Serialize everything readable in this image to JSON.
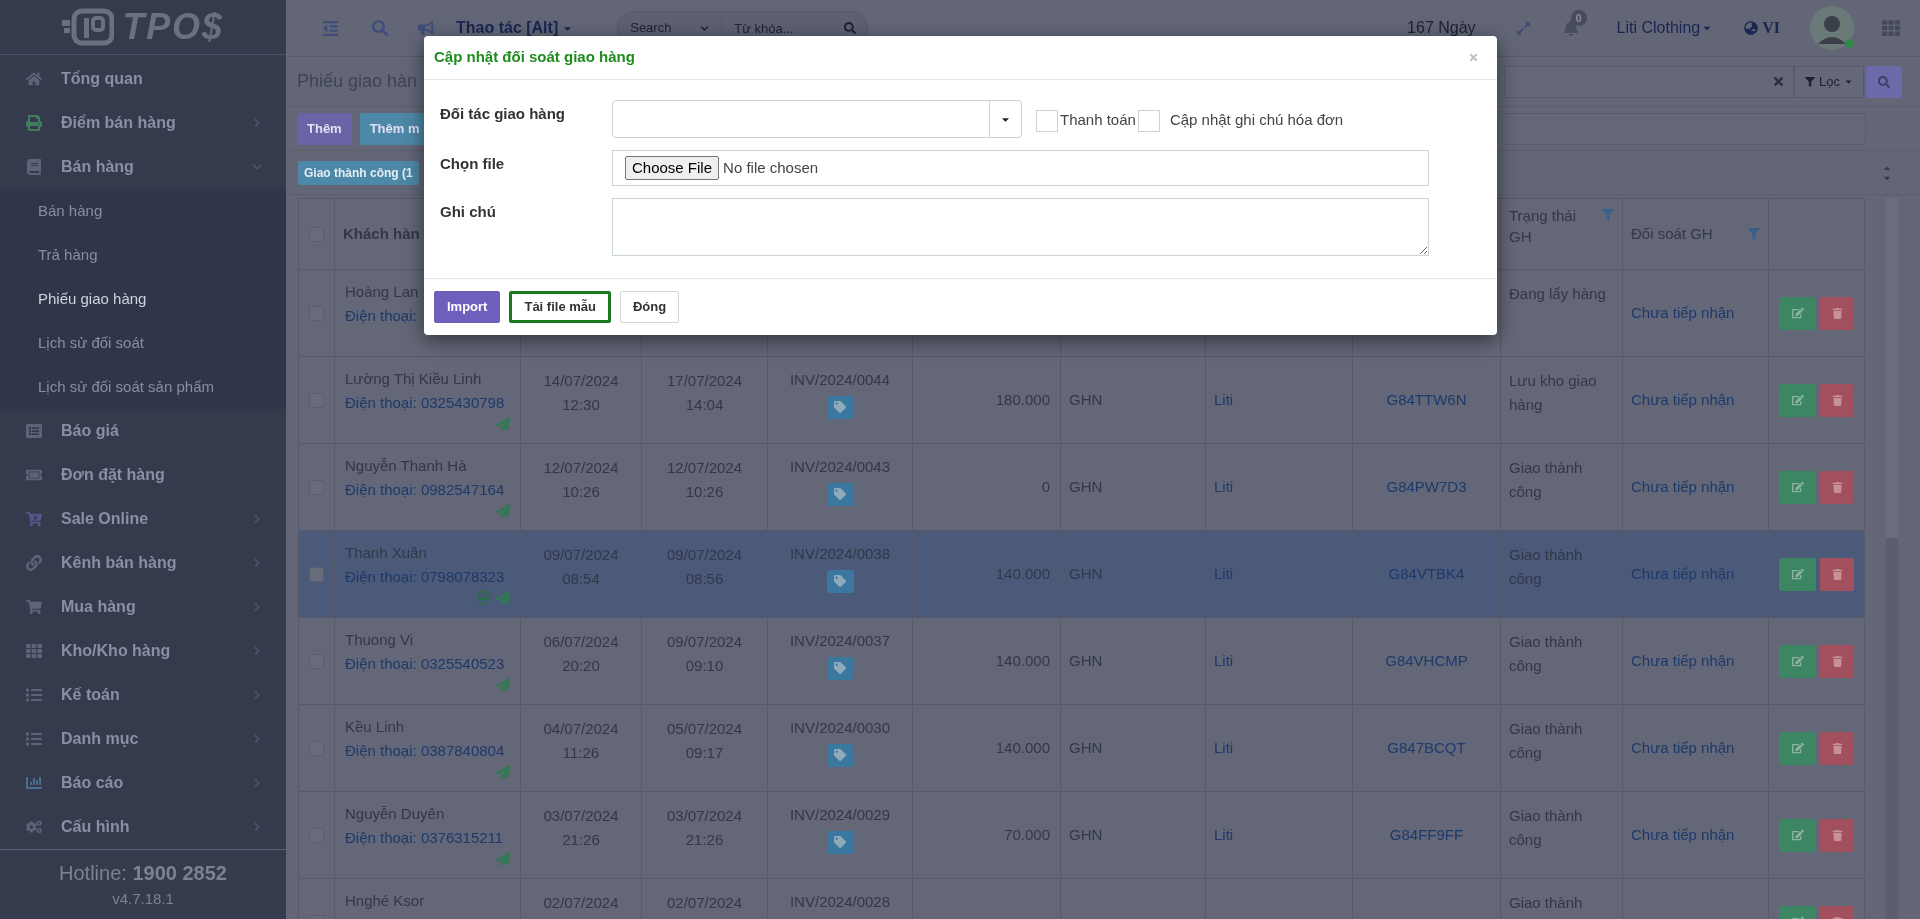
{
  "topbar": {
    "actions_menu": "Thao tác [Alt]",
    "search_scope": "Search",
    "search_placeholder": "Từ khóa...",
    "days_left": "167 Ngày",
    "notifications": "0",
    "company": "Liti Clothing",
    "language": "VI"
  },
  "sidebar": {
    "logo": "TPO$",
    "items": [
      {
        "label": "Tổng quan",
        "kind": "link"
      },
      {
        "label": "Điểm bán hàng",
        "kind": "group",
        "expanded": false
      },
      {
        "label": "Bán hàng",
        "kind": "group",
        "expanded": true,
        "children": [
          {
            "label": "Bán hàng",
            "selected": false
          },
          {
            "label": "Trả hàng",
            "selected": false
          },
          {
            "label": "Phiếu giao hàng",
            "selected": true
          },
          {
            "label": "Lịch sử đối soát",
            "selected": false
          },
          {
            "label": "Lịch sử đối soát sản phẩm",
            "selected": false
          }
        ]
      },
      {
        "label": "Báo giá",
        "kind": "link"
      },
      {
        "label": "Đơn đặt hàng",
        "kind": "link"
      },
      {
        "label": "Sale Online",
        "kind": "group",
        "expanded": false
      },
      {
        "label": "Kênh bán hàng",
        "kind": "group",
        "expanded": false
      },
      {
        "label": "Mua hàng",
        "kind": "group",
        "expanded": false
      },
      {
        "label": "Kho/Kho hàng",
        "kind": "group",
        "expanded": false
      },
      {
        "label": "Kế toán",
        "kind": "group",
        "expanded": false
      },
      {
        "label": "Danh mục",
        "kind": "group",
        "expanded": false
      },
      {
        "label": "Báo cáo",
        "kind": "group",
        "expanded": false
      },
      {
        "label": "Cấu hình",
        "kind": "group",
        "expanded": false
      }
    ],
    "hotline": "Hotline: **1900 2852**",
    "version": "v4.7.18.1"
  },
  "page": {
    "title": "Phiếu giao hàn",
    "buttons": [
      {
        "label": "Thêm",
        "kind": "primary"
      },
      {
        "label": "Thêm m",
        "kind": "info"
      }
    ],
    "filter_button": "Lọc",
    "active_filter": "Giao thành công (1"
  },
  "table": {
    "all_selected": false,
    "header": {
      "customer": "Khách hàn",
      "status": "Trạng thái GH",
      "reconciliation": "Đối soát GH"
    },
    "rows": [
      {
        "selected": false,
        "customer": "Hoàng Lan",
        "phone": "Điện thoại:",
        "status": "Đang lấy hàng",
        "reconciliation": "Chưa tiếp nhận"
      },
      {
        "selected": false,
        "customer": "Lường Thị Kiều Linh",
        "phone": "Điện thoại: 0325430798",
        "printed": false,
        "sent": true,
        "column_3": [
          "14/07/2024",
          "12:30"
        ],
        "column_4": [
          "17/07/2024",
          "14:04"
        ],
        "column_5": "INV/2024/0044",
        "column_6": "180.000",
        "column_7": "GHN",
        "column_8": "Liti",
        "column_9": "G84TTW6N",
        "status": "Lưu kho giao hàng",
        "reconciliation": "Chưa tiếp nhận"
      },
      {
        "selected": false,
        "customer": "Nguyễn Thanh Hà",
        "phone": "Điện thoại: 0982547164",
        "printed": false,
        "sent": true,
        "column_3": [
          "12/07/2024",
          "10:26"
        ],
        "column_4": [
          "12/07/2024",
          "10:26"
        ],
        "column_5": "INV/2024/0043",
        "column_6": "0",
        "column_7": "GHN",
        "column_8": "Liti",
        "column_9": "G84PW7D3",
        "status": "Giao thành công",
        "reconciliation": "Chưa tiếp nhận"
      },
      {
        "selected": true,
        "customer": "Thanh Xuân",
        "phone": "Điện thoại: 0798078323",
        "printed": true,
        "sent": true,
        "column_3": [
          "09/07/2024",
          "08:54"
        ],
        "column_4": [
          "09/07/2024",
          "08:56"
        ],
        "column_5": "INV/2024/0038",
        "column_6": "140.000",
        "column_7": "GHN",
        "column_8": "Liti",
        "column_9": "G84VTBK4",
        "status": "Giao thành công",
        "reconciliation": "Chưa tiếp nhận"
      },
      {
        "selected": false,
        "customer": "Thuong Vi",
        "phone": "Điện thoại: 0325540523",
        "printed": false,
        "sent": true,
        "column_3": [
          "06/07/2024",
          "20:20"
        ],
        "column_4": [
          "09/07/2024",
          "09:10"
        ],
        "column_5": "INV/2024/0037",
        "column_6": "140.000",
        "column_7": "GHN",
        "column_8": "Liti",
        "column_9": "G84VHCMP",
        "status": "Giao thành công",
        "reconciliation": "Chưa tiếp nhận"
      },
      {
        "selected": false,
        "customer": "Kều Linh",
        "phone": "Điện thoại: 0387840804",
        "printed": false,
        "sent": true,
        "column_3": [
          "04/07/2024",
          "11:26"
        ],
        "column_4": [
          "05/07/2024",
          "09:17"
        ],
        "column_5": "INV/2024/0030",
        "column_6": "140.000",
        "column_7": "GHN",
        "column_8": "Liti",
        "column_9": "G847BCQT",
        "status": "Giao thành công",
        "reconciliation": "Chưa tiếp nhận"
      },
      {
        "selected": false,
        "customer": "Nguyễn Duyên",
        "phone": "Điện thoại: 0376315211",
        "printed": false,
        "sent": true,
        "column_3": [
          "03/07/2024",
          "21:26"
        ],
        "column_4": [
          "03/07/2024",
          "21:26"
        ],
        "column_5": "INV/2024/0029",
        "column_6": "70.000",
        "column_7": "GHN",
        "column_8": "Liti",
        "column_9": "G84FF9FF",
        "status": "Giao thành công",
        "reconciliation": "Chưa tiếp nhận"
      },
      {
        "selected": false,
        "customer": "Hnghé Ksor",
        "column_3": [
          "02/07/2024"
        ],
        "column_4": [
          "02/07/2024"
        ],
        "column_5": "INV/2024/0028",
        "status": "Giao thành"
      }
    ]
  },
  "modal": {
    "title": "Cập nhật đối soát giao hàng",
    "partner_label": "Đối tác giao hàng",
    "options": [
      {
        "label": "Thanh toán",
        "checked": false
      },
      {
        "label": "Cập nhật ghi chú hóa đơn",
        "checked": false
      }
    ],
    "file_label": "Chọn file",
    "file_button": "Choose File",
    "file_status": "No file chosen",
    "note_label": "Ghi chú",
    "buttons": [
      {
        "label": "Import",
        "kind": "primary",
        "focused": false
      },
      {
        "label": "Tải file mẫu",
        "kind": "default",
        "focused": true
      },
      {
        "label": "Đóng",
        "kind": "default",
        "focused": false
      }
    ]
  }
}
